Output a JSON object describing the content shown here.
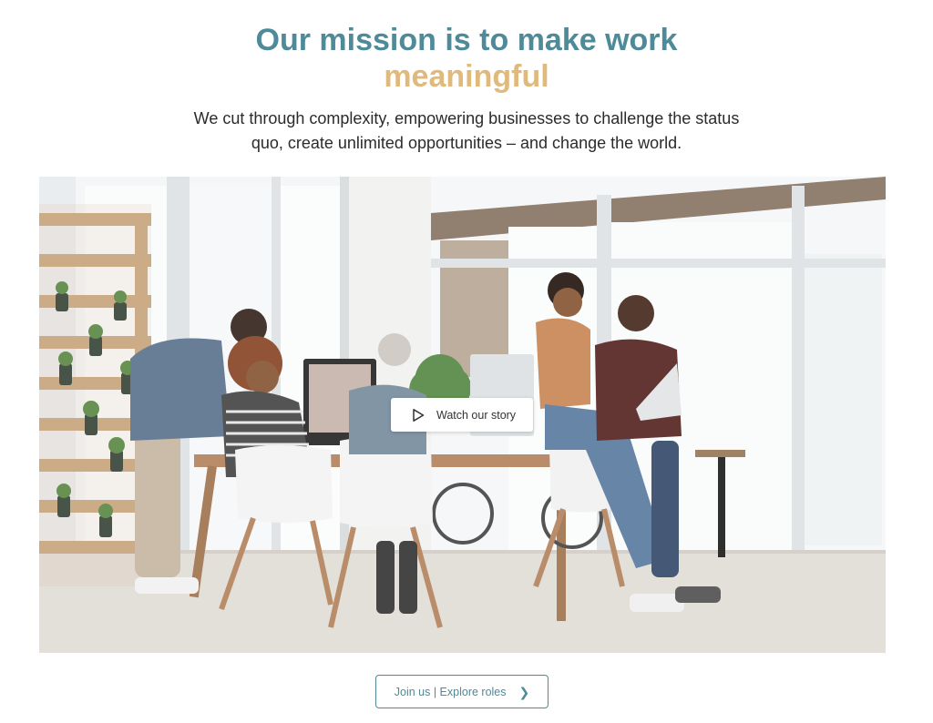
{
  "colors": {
    "teal": "#4e8a97",
    "gold": "#e0b97c"
  },
  "hero": {
    "headline_line1": "Our mission is to make work",
    "headline_line2": "meaningful",
    "subtitle": "We cut through complexity, empowering businesses to challenge the status quo, create unlimited opportunities – and change the world."
  },
  "image": {
    "alt": "Team of colleagues working together around a table in a bright office",
    "watch_button": {
      "label": "Watch our story",
      "icon": "play-icon"
    }
  },
  "cta": {
    "label": "Join us | Explore roles",
    "icon": "chevron-right-icon",
    "icon_glyph": "❯"
  }
}
